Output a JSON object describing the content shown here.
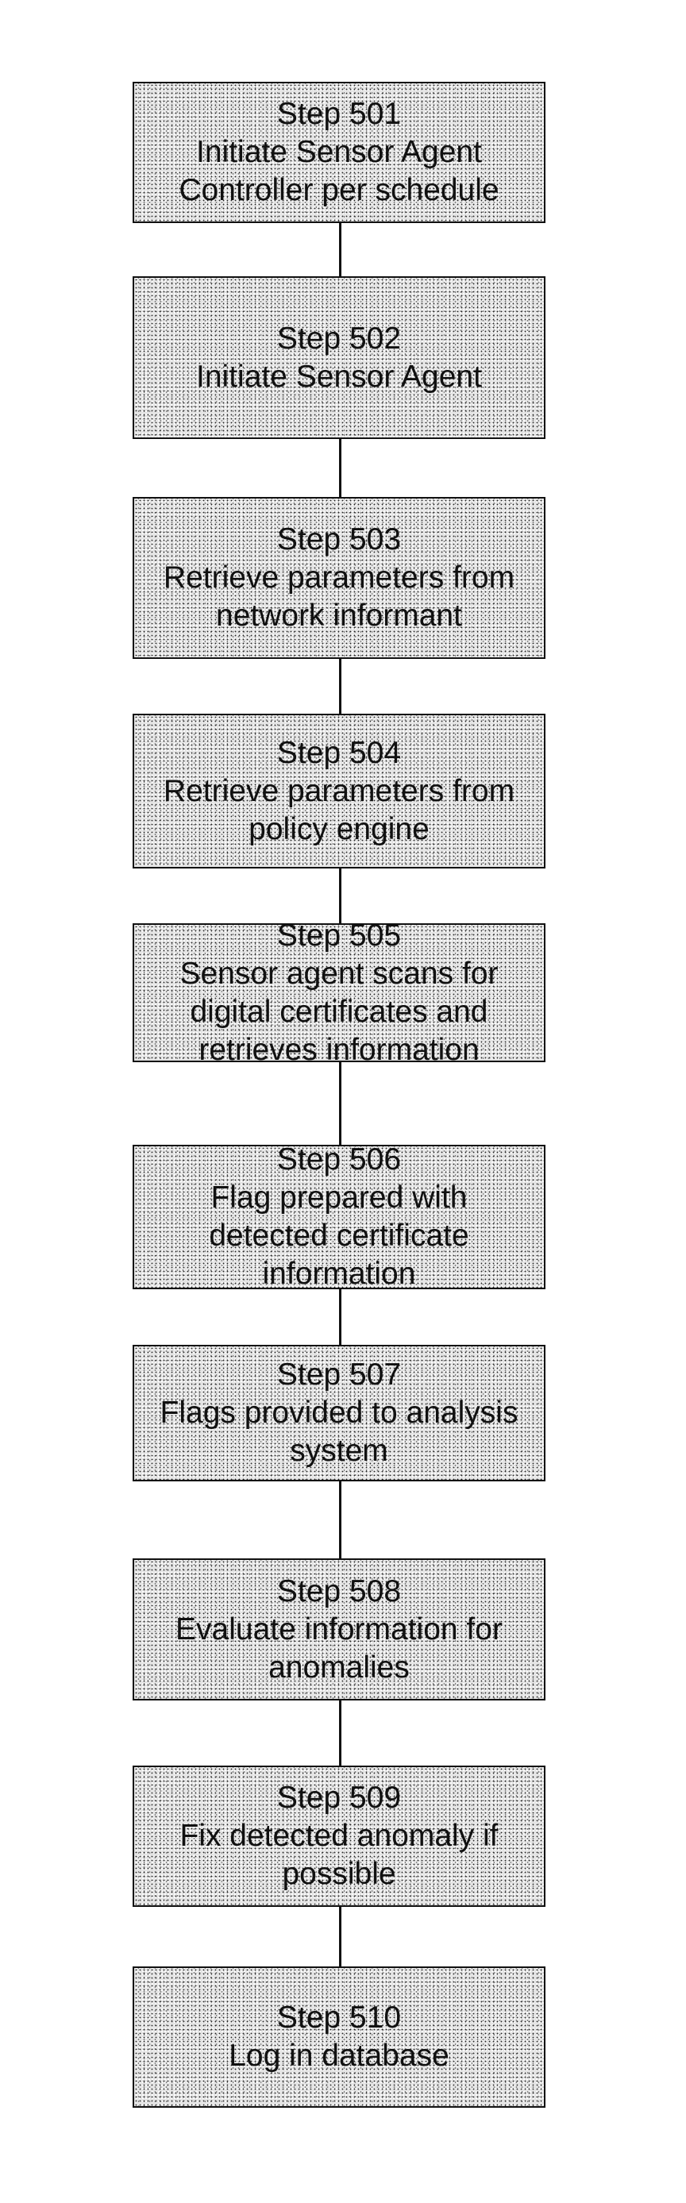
{
  "flowchart": {
    "steps": [
      {
        "id": "501",
        "label": "Step 501",
        "lines": [
          "Initiate Sensor Agent",
          "Controller per schedule"
        ]
      },
      {
        "id": "502",
        "label": "Step 502",
        "lines": [
          "Initiate Sensor Agent"
        ]
      },
      {
        "id": "503",
        "label": "Step 503",
        "lines": [
          "Retrieve parameters from",
          "network informant"
        ]
      },
      {
        "id": "504",
        "label": "Step 504",
        "lines": [
          "Retrieve parameters from",
          "policy engine"
        ]
      },
      {
        "id": "505",
        "label": "Step 505",
        "lines": [
          "Sensor agent scans for",
          "digital certificates and",
          "retrieves information"
        ]
      },
      {
        "id": "506",
        "label": "Step 506",
        "lines": [
          "Flag prepared with",
          "detected certificate",
          "information"
        ]
      },
      {
        "id": "507",
        "label": "Step 507",
        "lines": [
          "Flags provided to analysis",
          "system"
        ]
      },
      {
        "id": "508",
        "label": "Step 508",
        "lines": [
          "Evaluate information for",
          "anomalies"
        ]
      },
      {
        "id": "509",
        "label": "Step 509",
        "lines": [
          "Fix detected anomaly if",
          "possible"
        ]
      },
      {
        "id": "510",
        "label": "Step 510",
        "lines": [
          "Log in database"
        ]
      }
    ],
    "connections": [
      [
        "501",
        "502"
      ],
      [
        "502",
        "503"
      ],
      [
        "503",
        "504"
      ],
      [
        "504",
        "505"
      ],
      [
        "505",
        "506"
      ],
      [
        "506",
        "507"
      ],
      [
        "507",
        "508"
      ],
      [
        "508",
        "509"
      ],
      [
        "509",
        "510"
      ]
    ]
  }
}
